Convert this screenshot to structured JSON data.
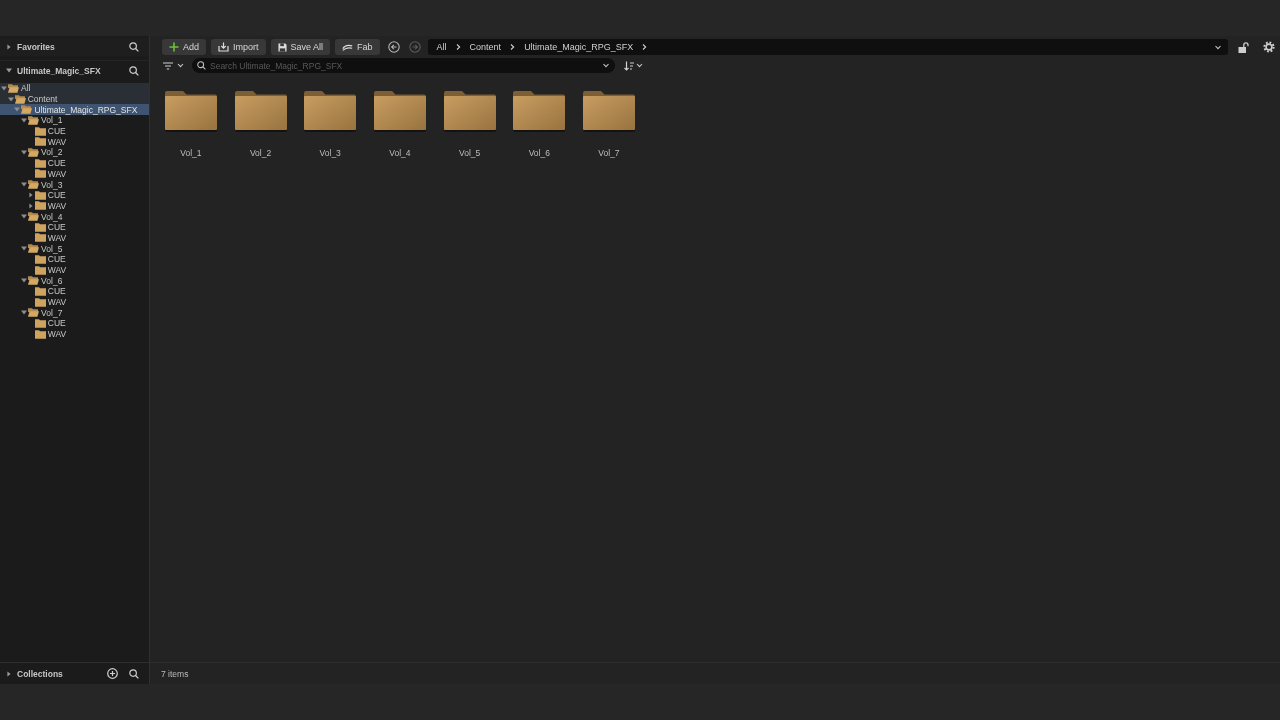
{
  "sidebar": {
    "favorites": {
      "title": "Favorites",
      "expanded": false
    },
    "source": {
      "title": "Ultimate_Magic_SFX",
      "expanded": true
    },
    "tree": [
      {
        "label": "All",
        "expanded": true,
        "selected": false,
        "highlighted": true,
        "children": [
          {
            "label": "Content",
            "expanded": true,
            "selected": false,
            "highlighted": true,
            "children": [
              {
                "label": "Ultimate_Magic_RPG_SFX",
                "expanded": true,
                "selected": true,
                "highlighted": false,
                "children": [
                  {
                    "label": "Vol_1",
                    "expanded": true,
                    "selected": false,
                    "highlighted": false,
                    "children": [
                      {
                        "label": "CUE",
                        "selected": false,
                        "highlighted": false
                      },
                      {
                        "label": "WAV",
                        "selected": false,
                        "highlighted": false
                      }
                    ]
                  },
                  {
                    "label": "Vol_2",
                    "expanded": true,
                    "selected": false,
                    "highlighted": false,
                    "children": [
                      {
                        "label": "CUE",
                        "selected": false,
                        "highlighted": false
                      },
                      {
                        "label": "WAV",
                        "selected": false,
                        "highlighted": false
                      }
                    ]
                  },
                  {
                    "label": "Vol_3",
                    "expanded": true,
                    "selected": false,
                    "highlighted": false,
                    "children": [
                      {
                        "label": "CUE",
                        "expanded": false,
                        "selected": false,
                        "highlighted": false
                      },
                      {
                        "label": "WAV",
                        "expanded": false,
                        "selected": false,
                        "highlighted": false
                      }
                    ]
                  },
                  {
                    "label": "Vol_4",
                    "expanded": true,
                    "selected": false,
                    "highlighted": false,
                    "children": [
                      {
                        "label": "CUE",
                        "selected": false,
                        "highlighted": false
                      },
                      {
                        "label": "WAV",
                        "selected": false,
                        "highlighted": false
                      }
                    ]
                  },
                  {
                    "label": "Vol_5",
                    "expanded": true,
                    "selected": false,
                    "highlighted": false,
                    "children": [
                      {
                        "label": "CUE",
                        "selected": false,
                        "highlighted": false
                      },
                      {
                        "label": "WAV",
                        "selected": false,
                        "highlighted": false
                      }
                    ]
                  },
                  {
                    "label": "Vol_6",
                    "expanded": true,
                    "selected": false,
                    "highlighted": false,
                    "children": [
                      {
                        "label": "CUE",
                        "selected": false,
                        "highlighted": false
                      },
                      {
                        "label": "WAV",
                        "selected": false,
                        "highlighted": false
                      }
                    ]
                  },
                  {
                    "label": "Vol_7",
                    "expanded": true,
                    "selected": false,
                    "highlighted": false,
                    "children": [
                      {
                        "label": "CUE",
                        "selected": false,
                        "highlighted": false
                      },
                      {
                        "label": "WAV",
                        "selected": false,
                        "highlighted": false
                      }
                    ]
                  }
                ]
              }
            ]
          }
        ]
      }
    ],
    "collections": {
      "title": "Collections",
      "expanded": false
    }
  },
  "toolbar": {
    "buttons": [
      {
        "kind": "add",
        "label": "Add"
      },
      {
        "kind": "import",
        "label": "Import"
      },
      {
        "kind": "save",
        "label": "Save All"
      },
      {
        "kind": "fab",
        "label": "Fab"
      }
    ],
    "back": {
      "disabled": false
    },
    "forward": {
      "disabled": true
    },
    "breadcrumb": [
      "All",
      "Content",
      "Ultimate_Magic_RPG_SFX"
    ]
  },
  "search": {
    "placeholder": "Search Ultimate_Magic_RPG_SFX"
  },
  "assets": [
    {
      "name": "Vol_1"
    },
    {
      "name": "Vol_2"
    },
    {
      "name": "Vol_3"
    },
    {
      "name": "Vol_4"
    },
    {
      "name": "Vol_5"
    },
    {
      "name": "Vol_6"
    },
    {
      "name": "Vol_7"
    }
  ],
  "status_bar": {
    "text": "7 items"
  }
}
